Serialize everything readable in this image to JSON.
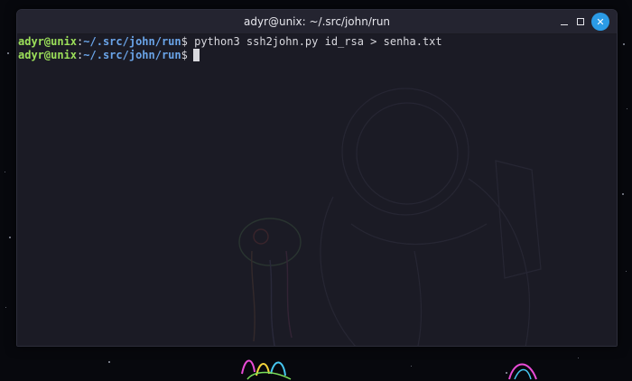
{
  "window": {
    "title": "adyr@unix: ~/.src/john/run",
    "controls": {
      "minimize_icon": "minimize-icon",
      "maximize_icon": "maximize-icon",
      "close_icon": "close-icon",
      "close_color": "#2b9be6"
    }
  },
  "terminal": {
    "lines": [
      {
        "user_host": "adyr@unix",
        "separator": ":",
        "path": "~/.src/john/run",
        "prompt_symbol": "$",
        "command": " python3 ssh2john.py id_rsa > senha.txt"
      },
      {
        "user_host": "adyr@unix",
        "separator": ":",
        "path": "~/.src/john/run",
        "prompt_symbol": "$",
        "command": ""
      }
    ],
    "colors": {
      "background": "#1b1b25",
      "user_host": "#9ce05a",
      "path": "#6aa4e8",
      "text": "#d8d8de"
    }
  },
  "desktop": {
    "background": "#07080d"
  }
}
